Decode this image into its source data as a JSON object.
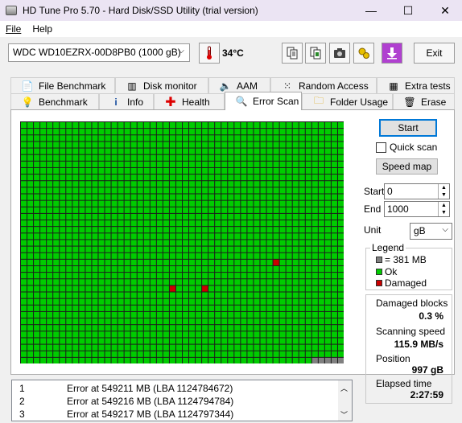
{
  "window": {
    "title": "HD Tune Pro 5.70 - Hard Disk/SSD Utility (trial version)",
    "minimize": "—",
    "maximize": "☐",
    "close": "✕"
  },
  "menu": {
    "file": "File",
    "help": "Help"
  },
  "toolbar": {
    "drive": "WDC WD10EZRX-00D8PB0 (1000 gB)",
    "temperature": "34°C",
    "exit": "Exit"
  },
  "tabs_top": [
    "File Benchmark",
    "Disk monitor",
    "AAM",
    "Random Access",
    "Extra tests"
  ],
  "tabs_bottom": [
    "Benchmark",
    "Info",
    "Health",
    "Error Scan",
    "Folder Usage",
    "Erase"
  ],
  "controls": {
    "start_button": "Start",
    "quick_scan": "Quick scan",
    "speed_map": "Speed map",
    "start_label": "Start",
    "start_value": "0",
    "end_label": "End",
    "end_value": "1000",
    "unit_label": "Unit",
    "unit_value": "gB"
  },
  "legend": {
    "title": "Legend",
    "block": "= 381 MB",
    "ok": "Ok",
    "damaged": "Damaged",
    "colors": {
      "block": "#808080",
      "ok": "#00cc00",
      "damaged": "#cc0000"
    }
  },
  "stats": {
    "damaged_label": "Damaged blocks",
    "damaged_value": "0.3 %",
    "speed_label": "Scanning speed",
    "speed_value": "115.9 MB/s",
    "position_label": "Position",
    "position_value": "997 gB",
    "elapsed_label": "Elapsed time",
    "elapsed_value": "2:27:59"
  },
  "log": [
    {
      "num": "1",
      "msg": "Error at 549211 MB (LBA 1124784672)"
    },
    {
      "num": "2",
      "msg": "Error at 549216 MB (LBA 1124794784)"
    },
    {
      "num": "3",
      "msg": "Error at 549217 MB (LBA 1124797344)"
    }
  ],
  "scan_grid": {
    "columns": 50,
    "rows": 37,
    "damaged_cells": [
      [
        39,
        21
      ],
      [
        23,
        25
      ],
      [
        28,
        25
      ]
    ],
    "unscanned_last_row_from_col": 45
  }
}
